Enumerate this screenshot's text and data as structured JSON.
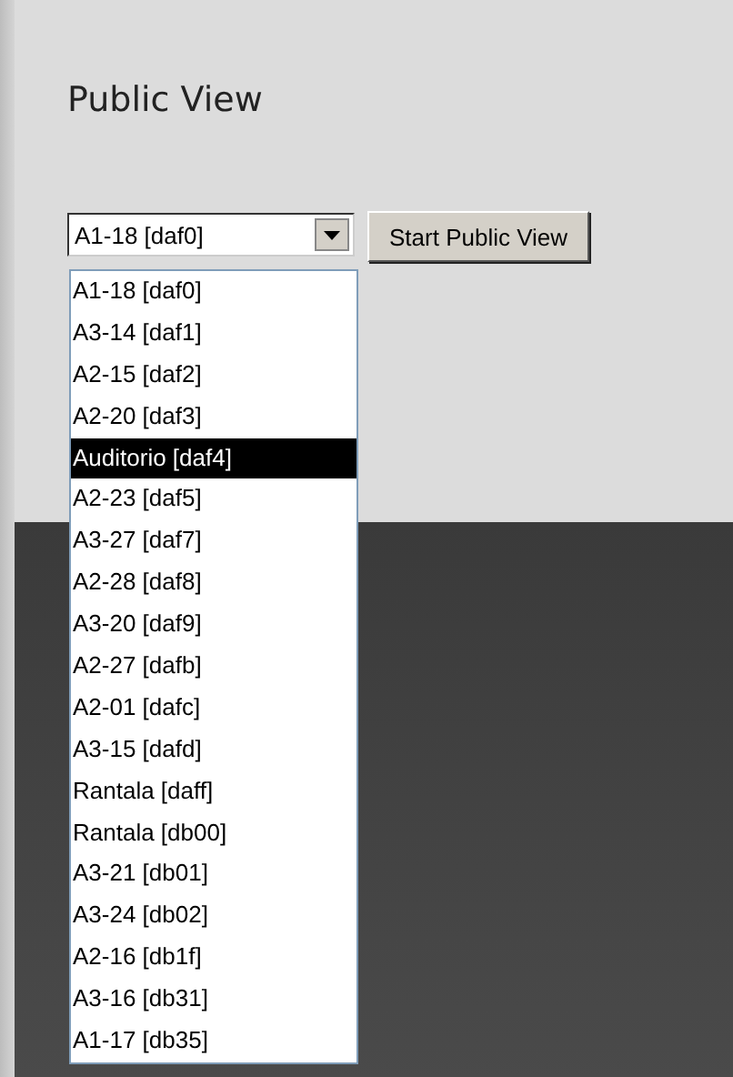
{
  "title": "Public View",
  "select": {
    "value": "A1-18 [daf0]",
    "expanded": true
  },
  "start_button": "Start Public View",
  "options": [
    {
      "label": "A1-18 [daf0]",
      "selected": false
    },
    {
      "label": "A3-14 [daf1]",
      "selected": false
    },
    {
      "label": "A2-15 [daf2]",
      "selected": false
    },
    {
      "label": "A2-20 [daf3]",
      "selected": false
    },
    {
      "label": "Auditorio [daf4]",
      "selected": true
    },
    {
      "label": "A2-23 [daf5]",
      "selected": false
    },
    {
      "label": "A3-27 [daf7]",
      "selected": false
    },
    {
      "label": "A2-28 [daf8]",
      "selected": false
    },
    {
      "label": "A3-20 [daf9]",
      "selected": false
    },
    {
      "label": "A2-27 [dafb]",
      "selected": false
    },
    {
      "label": "A2-01 [dafc]",
      "selected": false
    },
    {
      "label": "A3-15 [dafd]",
      "selected": false
    },
    {
      "label": "Rantala [daff]",
      "selected": false
    },
    {
      "label": "Rantala [db00]",
      "selected": false
    },
    {
      "label": "A3-21 [db01]",
      "selected": false
    },
    {
      "label": "A3-24 [db02]",
      "selected": false
    },
    {
      "label": "A2-16 [db1f]",
      "selected": false
    },
    {
      "label": "A3-16 [db31]",
      "selected": false
    },
    {
      "label": "A1-17 [db35]",
      "selected": false
    }
  ]
}
